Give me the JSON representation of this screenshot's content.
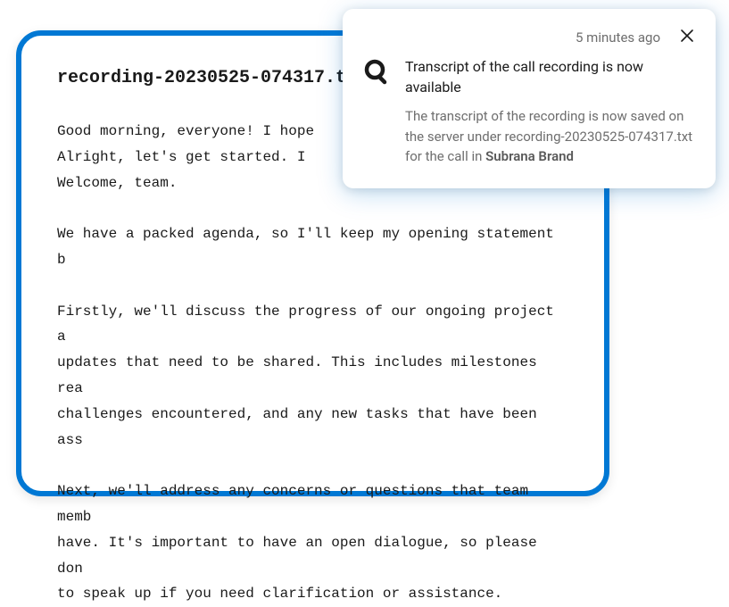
{
  "transcript": {
    "filename": "recording-20230525-074317.txt",
    "body": "Good morning, everyone! I hope \nAlright, let's get started. I \nWelcome, team.\n\nWe have a packed agenda, so I'll keep my opening statement b\n\nFirstly, we'll discuss the progress of our ongoing project a\nupdates that need to be shared. This includes milestones rea\nchallenges encountered, and any new tasks that have been ass\n\nNext, we'll address any concerns or questions that team memb\nhave. It's important to have an open dialogue, so please don\nto speak up if you need clarification or assistance."
  },
  "notification": {
    "timestamp": "5 minutes ago",
    "title": "Transcript of the call recording is now available",
    "description_prefix": "The transcript of the recording is now saved on the server under ",
    "filename": "recording-20230525-074317.txt",
    "description_middle": " for the call in ",
    "brand": "Subrana Brand"
  }
}
